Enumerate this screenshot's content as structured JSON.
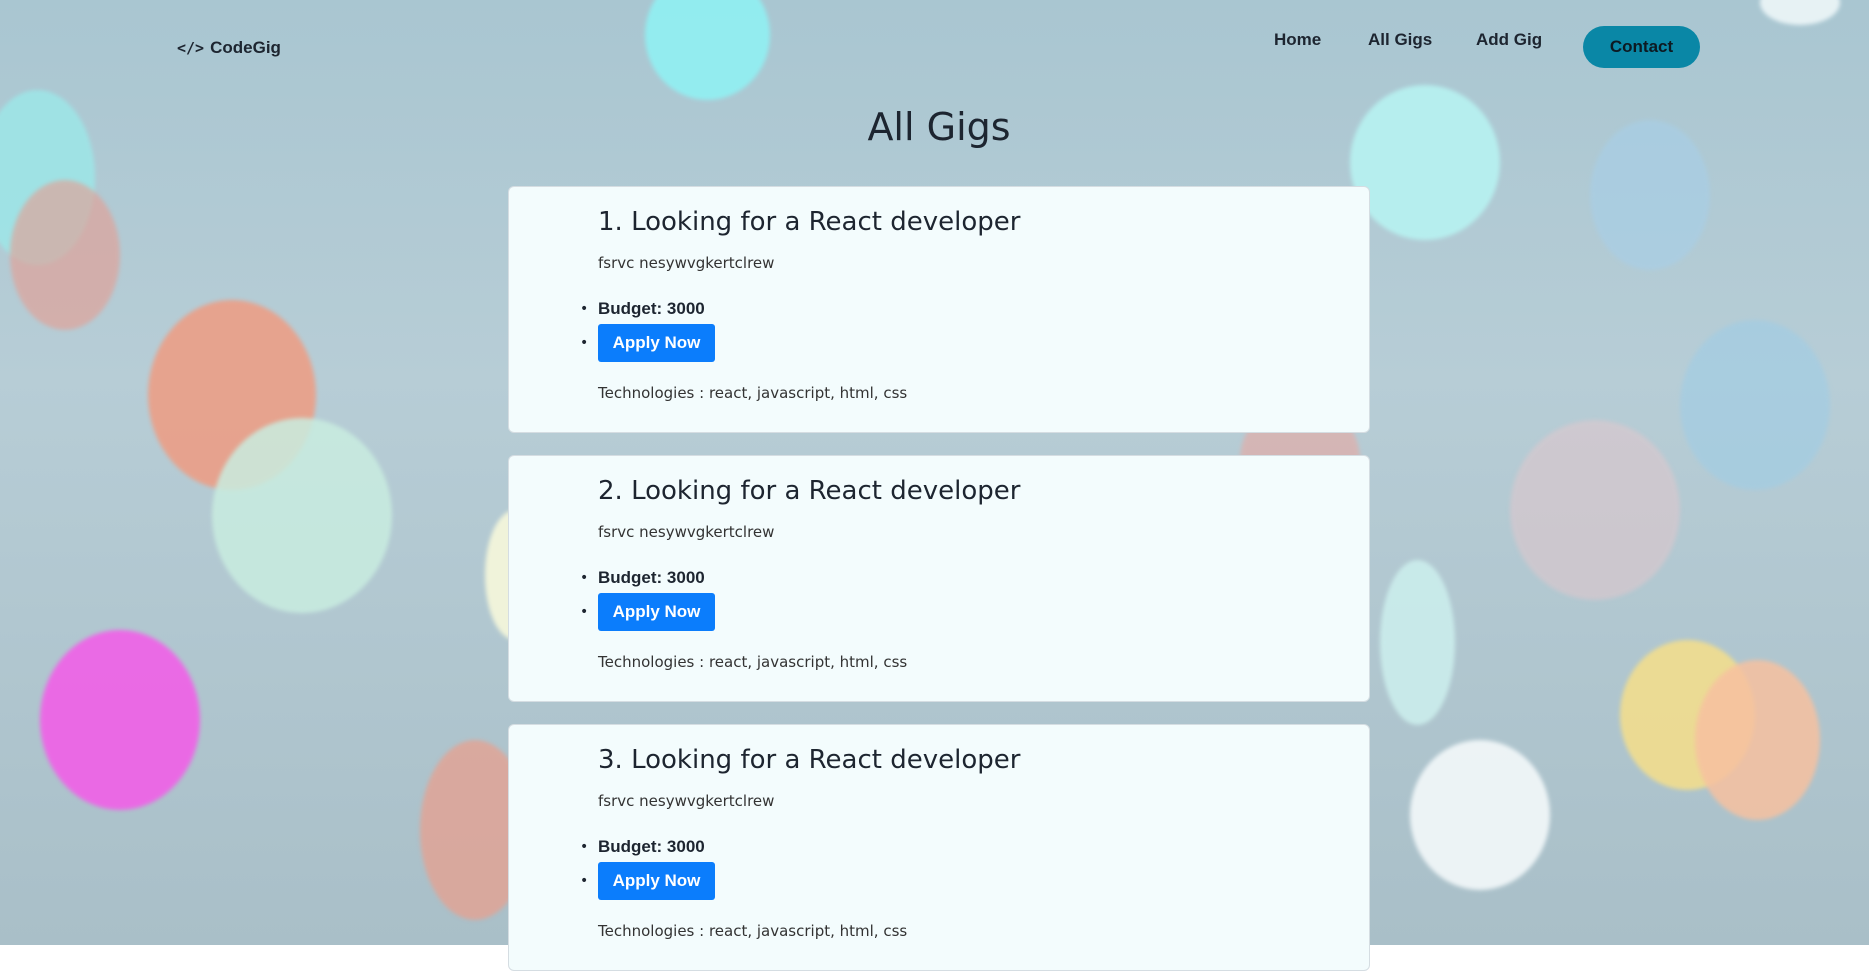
{
  "nav": {
    "logo_icon": "</>",
    "logo_text": "CodeGig",
    "links": [
      "Home",
      "All Gigs",
      "Add Gig"
    ],
    "contact_label": "Contact"
  },
  "main": {
    "title": "All Gigs",
    "gigs": [
      {
        "title": "1. Looking for a React developer",
        "description": "fsrvc nesywvgkertclrew",
        "budget": "Budget: 3000",
        "apply_label": "Apply Now",
        "technologies": "Technologies : react, javascript, html, css"
      },
      {
        "title": "2. Looking for a React developer",
        "description": "fsrvc nesywvgkertclrew",
        "budget": "Budget: 3000",
        "apply_label": "Apply Now",
        "technologies": "Technologies : react, javascript, html, css"
      },
      {
        "title": "3. Looking for a React developer",
        "description": "fsrvc nesywvgkertclrew",
        "budget": "Budget: 3000",
        "apply_label": "Apply Now",
        "technologies": "Technologies : react, javascript, html, css"
      }
    ]
  },
  "colors": {
    "contact_button": "#0a87a6",
    "apply_button": "#0b7dfc",
    "card_background": "#f3fcfd",
    "text_dark": "#1d2530"
  }
}
